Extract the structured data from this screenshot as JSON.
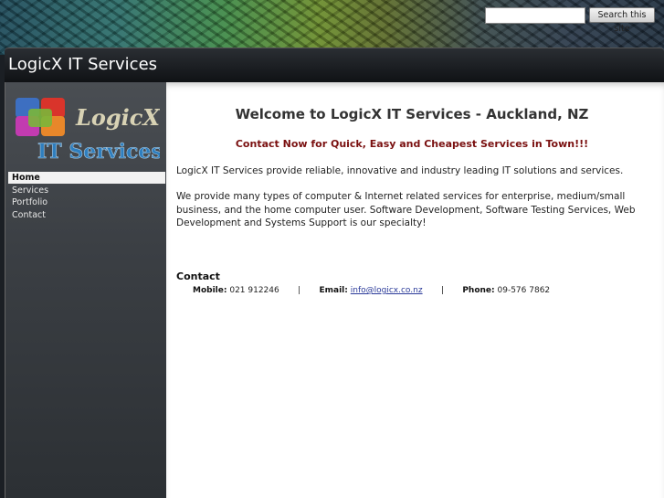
{
  "search": {
    "placeholder": "",
    "value": "",
    "button_label": "Search this site"
  },
  "site": {
    "title": "LogicX IT Services"
  },
  "logo": {
    "line1": "LogicX",
    "line2": "IT Services",
    "colors": [
      "#d9342b",
      "#e8872a",
      "#7ab63a",
      "#3d6fc1",
      "#c23bb0"
    ]
  },
  "nav": {
    "items": [
      {
        "label": "Home",
        "active": true
      },
      {
        "label": "Services",
        "active": false
      },
      {
        "label": "Portfolio",
        "active": false
      },
      {
        "label": "Contact",
        "active": false
      }
    ]
  },
  "main": {
    "heading": "Welcome to LogicX IT Services - Auckland, NZ",
    "tagline": "Contact Now for Quick, Easy and Cheapest Services in Town!!!",
    "paragraph1": "LogicX IT Services provide reliable, innovative and industry leading IT solutions and services.",
    "paragraph2": "We provide many types of computer & Internet related services for enterprise, medium/small business, and the home computer user. Software Development, Software Testing Services, Web Development and Systems Support is our specialty!"
  },
  "contact": {
    "heading": "Contact",
    "mobile_label": "Mobile:",
    "mobile_value": "021 912246",
    "separator": "|",
    "email_label": "Email:",
    "email_value": "info@logicx.co.nz",
    "phone_label": "Phone:",
    "phone_value": "09-576 7862"
  },
  "colors": {
    "tagline": "#7a1010",
    "link": "#2a3a99"
  }
}
